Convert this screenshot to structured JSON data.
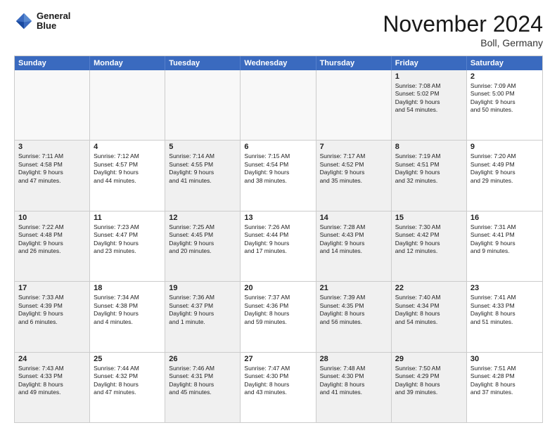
{
  "logo": {
    "line1": "General",
    "line2": "Blue"
  },
  "title": "November 2024",
  "subtitle": "Boll, Germany",
  "days": [
    "Sunday",
    "Monday",
    "Tuesday",
    "Wednesday",
    "Thursday",
    "Friday",
    "Saturday"
  ],
  "rows": [
    [
      {
        "day": "",
        "text": "",
        "empty": true
      },
      {
        "day": "",
        "text": "",
        "empty": true
      },
      {
        "day": "",
        "text": "",
        "empty": true
      },
      {
        "day": "",
        "text": "",
        "empty": true
      },
      {
        "day": "",
        "text": "",
        "empty": true
      },
      {
        "day": "1",
        "text": "Sunrise: 7:08 AM\nSunset: 5:02 PM\nDaylight: 9 hours\nand 54 minutes.",
        "shaded": true
      },
      {
        "day": "2",
        "text": "Sunrise: 7:09 AM\nSunset: 5:00 PM\nDaylight: 9 hours\nand 50 minutes."
      }
    ],
    [
      {
        "day": "3",
        "text": "Sunrise: 7:11 AM\nSunset: 4:58 PM\nDaylight: 9 hours\nand 47 minutes.",
        "shaded": true
      },
      {
        "day": "4",
        "text": "Sunrise: 7:12 AM\nSunset: 4:57 PM\nDaylight: 9 hours\nand 44 minutes."
      },
      {
        "day": "5",
        "text": "Sunrise: 7:14 AM\nSunset: 4:55 PM\nDaylight: 9 hours\nand 41 minutes.",
        "shaded": true
      },
      {
        "day": "6",
        "text": "Sunrise: 7:15 AM\nSunset: 4:54 PM\nDaylight: 9 hours\nand 38 minutes."
      },
      {
        "day": "7",
        "text": "Sunrise: 7:17 AM\nSunset: 4:52 PM\nDaylight: 9 hours\nand 35 minutes.",
        "shaded": true
      },
      {
        "day": "8",
        "text": "Sunrise: 7:19 AM\nSunset: 4:51 PM\nDaylight: 9 hours\nand 32 minutes.",
        "shaded": true
      },
      {
        "day": "9",
        "text": "Sunrise: 7:20 AM\nSunset: 4:49 PM\nDaylight: 9 hours\nand 29 minutes."
      }
    ],
    [
      {
        "day": "10",
        "text": "Sunrise: 7:22 AM\nSunset: 4:48 PM\nDaylight: 9 hours\nand 26 minutes.",
        "shaded": true
      },
      {
        "day": "11",
        "text": "Sunrise: 7:23 AM\nSunset: 4:47 PM\nDaylight: 9 hours\nand 23 minutes."
      },
      {
        "day": "12",
        "text": "Sunrise: 7:25 AM\nSunset: 4:45 PM\nDaylight: 9 hours\nand 20 minutes.",
        "shaded": true
      },
      {
        "day": "13",
        "text": "Sunrise: 7:26 AM\nSunset: 4:44 PM\nDaylight: 9 hours\nand 17 minutes."
      },
      {
        "day": "14",
        "text": "Sunrise: 7:28 AM\nSunset: 4:43 PM\nDaylight: 9 hours\nand 14 minutes.",
        "shaded": true
      },
      {
        "day": "15",
        "text": "Sunrise: 7:30 AM\nSunset: 4:42 PM\nDaylight: 9 hours\nand 12 minutes.",
        "shaded": true
      },
      {
        "day": "16",
        "text": "Sunrise: 7:31 AM\nSunset: 4:41 PM\nDaylight: 9 hours\nand 9 minutes."
      }
    ],
    [
      {
        "day": "17",
        "text": "Sunrise: 7:33 AM\nSunset: 4:39 PM\nDaylight: 9 hours\nand 6 minutes.",
        "shaded": true
      },
      {
        "day": "18",
        "text": "Sunrise: 7:34 AM\nSunset: 4:38 PM\nDaylight: 9 hours\nand 4 minutes."
      },
      {
        "day": "19",
        "text": "Sunrise: 7:36 AM\nSunset: 4:37 PM\nDaylight: 9 hours\nand 1 minute.",
        "shaded": true
      },
      {
        "day": "20",
        "text": "Sunrise: 7:37 AM\nSunset: 4:36 PM\nDaylight: 8 hours\nand 59 minutes."
      },
      {
        "day": "21",
        "text": "Sunrise: 7:39 AM\nSunset: 4:35 PM\nDaylight: 8 hours\nand 56 minutes.",
        "shaded": true
      },
      {
        "day": "22",
        "text": "Sunrise: 7:40 AM\nSunset: 4:34 PM\nDaylight: 8 hours\nand 54 minutes.",
        "shaded": true
      },
      {
        "day": "23",
        "text": "Sunrise: 7:41 AM\nSunset: 4:33 PM\nDaylight: 8 hours\nand 51 minutes."
      }
    ],
    [
      {
        "day": "24",
        "text": "Sunrise: 7:43 AM\nSunset: 4:33 PM\nDaylight: 8 hours\nand 49 minutes.",
        "shaded": true
      },
      {
        "day": "25",
        "text": "Sunrise: 7:44 AM\nSunset: 4:32 PM\nDaylight: 8 hours\nand 47 minutes."
      },
      {
        "day": "26",
        "text": "Sunrise: 7:46 AM\nSunset: 4:31 PM\nDaylight: 8 hours\nand 45 minutes.",
        "shaded": true
      },
      {
        "day": "27",
        "text": "Sunrise: 7:47 AM\nSunset: 4:30 PM\nDaylight: 8 hours\nand 43 minutes."
      },
      {
        "day": "28",
        "text": "Sunrise: 7:48 AM\nSunset: 4:30 PM\nDaylight: 8 hours\nand 41 minutes.",
        "shaded": true
      },
      {
        "day": "29",
        "text": "Sunrise: 7:50 AM\nSunset: 4:29 PM\nDaylight: 8 hours\nand 39 minutes.",
        "shaded": true
      },
      {
        "day": "30",
        "text": "Sunrise: 7:51 AM\nSunset: 4:28 PM\nDaylight: 8 hours\nand 37 minutes."
      }
    ]
  ]
}
